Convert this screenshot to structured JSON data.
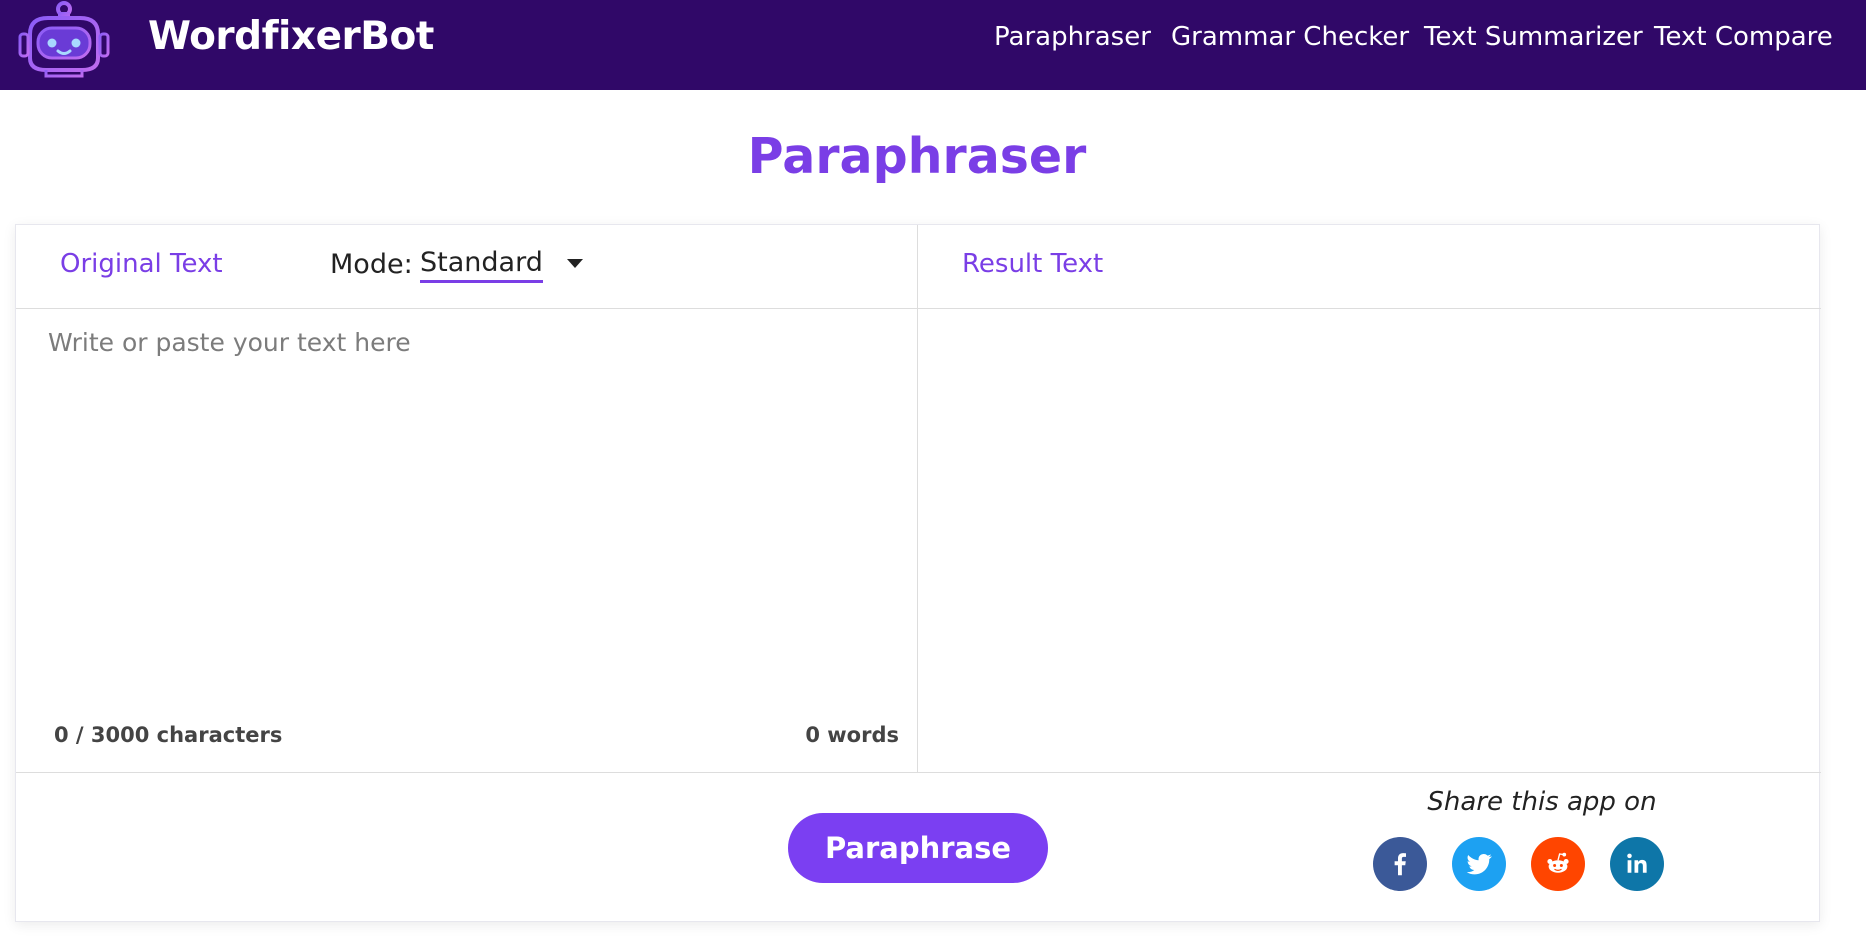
{
  "header": {
    "brand": "WordfixerBot",
    "logo_icon": "robot-icon",
    "nav": [
      "Paraphraser",
      "Grammar Checker",
      "Text Summarizer",
      "Text Compare"
    ]
  },
  "main": {
    "title": "Paraphraser",
    "original_label": "Original Text",
    "mode_label": "Mode:",
    "mode_value": "Standard",
    "input_placeholder": "Write or paste your text here",
    "result_label": "Result Text",
    "char_count": "0 / 3000 characters",
    "word_count": "0 words",
    "button_label": "Paraphrase"
  },
  "share": {
    "label": "Share this app on",
    "networks": [
      "facebook-icon",
      "twitter-icon",
      "reddit-icon",
      "linkedin-icon"
    ]
  },
  "colors": {
    "nav_bg": "#300868",
    "accent": "#7b3ff2",
    "facebook": "#3b5998",
    "twitter": "#1da1f2",
    "reddit": "#ff4500",
    "linkedin": "#0e76a8"
  }
}
